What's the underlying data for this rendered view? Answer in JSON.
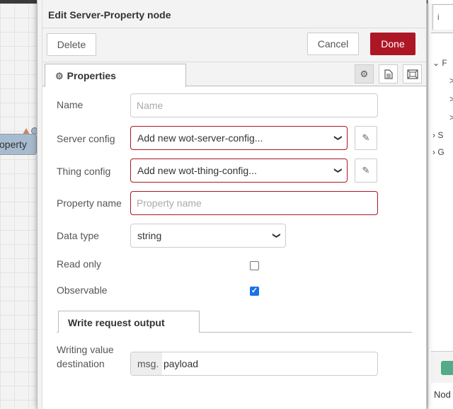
{
  "tray": {
    "title": "Edit Server-Property node",
    "delete_label": "Delete",
    "cancel_label": "Cancel",
    "done_label": "Done",
    "accent_color": "#ad1625"
  },
  "tabs": {
    "properties_label": "Properties",
    "icons": [
      "gear-icon",
      "description-icon",
      "appearance-icon"
    ]
  },
  "form": {
    "name_label": "Name",
    "name_placeholder": "Name",
    "server_config_label": "Server config",
    "server_config_value": "Add new wot-server-config...",
    "thing_config_label": "Thing config",
    "thing_config_value": "Add new wot-thing-config...",
    "property_name_label": "Property name",
    "property_name_placeholder": "Property name",
    "data_type_label": "Data type",
    "data_type_value": "string",
    "read_only_label": "Read only",
    "read_only_checked": false,
    "observable_label": "Observable",
    "observable_checked": true
  },
  "write_section": {
    "tab_label": "Write request output",
    "dest_label_line1": "Writing value",
    "dest_label_line2": "destination",
    "prefix": "msg.",
    "value": "payload"
  },
  "canvas": {
    "node_label": "operty"
  },
  "sidebar": {
    "tab_label": "i",
    "rows": [
      "F",
      ">",
      ">",
      ">",
      "S",
      "G"
    ],
    "bottom_label": "Nod"
  }
}
